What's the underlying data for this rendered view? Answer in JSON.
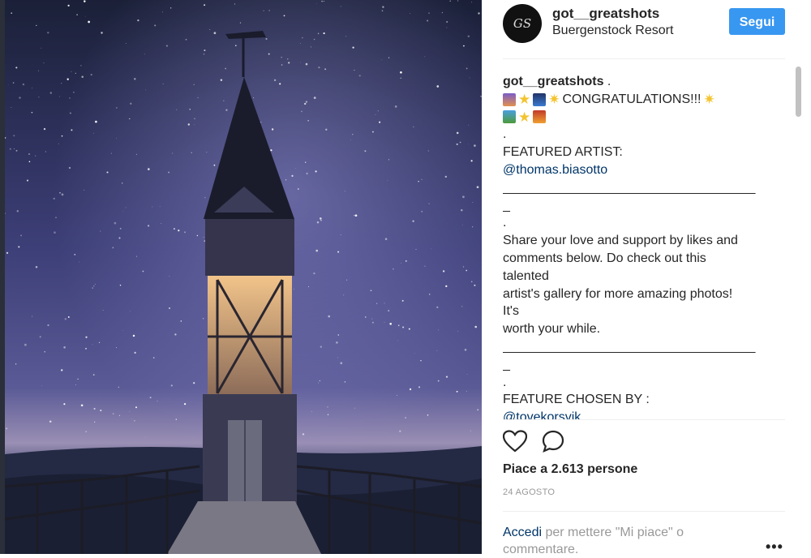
{
  "post": {
    "username": "got__greatshots",
    "location": "Buergenstock Resort",
    "follow_label": "Segui",
    "avatar_text": "GS"
  },
  "caption": {
    "username": "got__greatshots",
    "after_username": " .",
    "congrats": "CONGRATULATIONS!!!",
    "dot": ".",
    "featured_artist": "FEATURED ARTIST:",
    "artist_handle": "@thomas.biasotto",
    "separator": "___________________________________",
    "separator_tail": "_",
    "body_line_1": "Share your love and support by likes and",
    "body_line_2": "comments below. Do check out this",
    "body_line_3": "talented",
    "body_line_4": "artist's gallery for more amazing photos!",
    "body_line_5": "It's",
    "body_line_6": "worth your while.",
    "chosen_by": "FEATURE CHOSEN BY :",
    "chooser_handle": "@tovekorsvik"
  },
  "actions": {
    "like_icon": "heart-icon",
    "comment_icon": "comment-icon"
  },
  "likes_text": "Piace a 2.613 persone",
  "date_text": "24 AGOSTO",
  "login": {
    "link": "Accedi",
    "text": " per mettere \"Mi piace\" o commentare."
  },
  "more_label": "•••",
  "colors": {
    "follow_button": "#3897f0",
    "link": "#003569",
    "text": "#262626",
    "muted": "#999999"
  }
}
